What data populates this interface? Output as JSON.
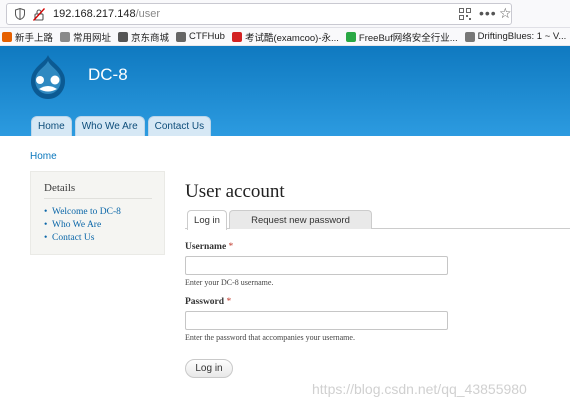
{
  "browser": {
    "url_host": "192.168.217.148",
    "url_path": "/user",
    "more_label": "•••",
    "bookmarks": [
      {
        "label": "新手上路",
        "color": "#e66000"
      },
      {
        "label": "常用网址",
        "color": "#8a8a8a"
      },
      {
        "label": "京东商城",
        "color": "#555555"
      },
      {
        "label": "CTFHub",
        "color": "#666666"
      },
      {
        "label": "考试酷(examcoo)-永...",
        "color": "#d22222"
      },
      {
        "label": "FreeBuf网络安全行业...",
        "color": "#2aa845"
      },
      {
        "label": "DriftingBlues: 1 ~ V...",
        "color": "#777777"
      }
    ]
  },
  "site": {
    "name": "DC-8",
    "nav": [
      "Home",
      "Who We Are",
      "Contact Us"
    ]
  },
  "breadcrumb": "Home",
  "sidebar": {
    "title": "Details",
    "links": [
      "Welcome to DC-8",
      "Who We Are",
      "Contact Us"
    ]
  },
  "main": {
    "title": "User account",
    "tabs": [
      "Log in",
      "Request new password"
    ],
    "username_label": "Username",
    "username_desc": "Enter your DC-8 username.",
    "password_label": "Password",
    "password_desc": "Enter the password that accompanies your username.",
    "required_mark": "*",
    "submit_label": "Log in"
  },
  "watermark": "https://blog.csdn.net/qq_43855980",
  "colors": {
    "header_top": "#0f79c0",
    "header_bottom": "#2c9be0",
    "link": "#0a77bd",
    "required": "#c0392b"
  }
}
